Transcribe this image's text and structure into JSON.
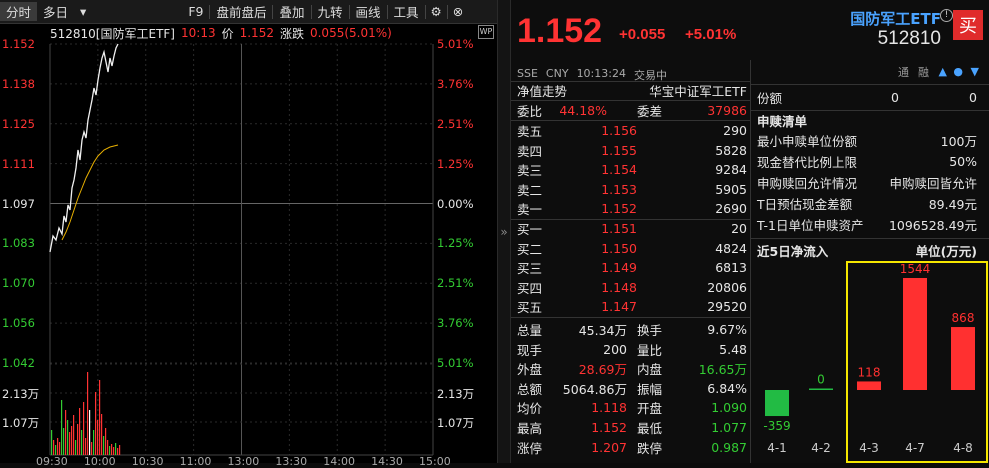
{
  "toolbar": {
    "items": [
      "分时",
      "多日",
      "▾",
      "F9",
      "盘前盘后",
      "叠加",
      "九转",
      "画线",
      "工具"
    ]
  },
  "chart_header": {
    "code_name": "512810[国防军工ETF]",
    "time": "10:13",
    "price_label": "价",
    "price": "1.152",
    "chg_label": "涨跌",
    "chg": "0.055(5.01%)"
  },
  "y_left": [
    "1.152",
    "1.138",
    "1.125",
    "1.111",
    "1.097",
    "1.083",
    "1.070",
    "1.056",
    "1.042"
  ],
  "y_right": [
    "5.01%",
    "3.76%",
    "2.51%",
    "1.25%",
    "0.00%",
    "1.25%",
    "2.51%",
    "3.76%",
    "5.01%"
  ],
  "vol_left": [
    "2.13万",
    "1.07万"
  ],
  "vol_right": [
    "2.13万",
    "1.07万"
  ],
  "x_labels": [
    "09:30",
    "10:00",
    "10:30",
    "11:00",
    "13:00",
    "13:30",
    "14:00",
    "14:30",
    "15:00"
  ],
  "quote": {
    "price": "1.152",
    "chg": "+0.055",
    "pct": "+5.01%",
    "name": "国防军工ETF",
    "code": "512810",
    "buy": "买",
    "info": [
      "SSE",
      "CNY",
      "10:13:24",
      "交易中"
    ],
    "nav_label": "净值走势",
    "index_name": "华宝中证军工ETF"
  },
  "ratio": {
    "wb_label": "委比",
    "wb": "44.18%",
    "wc_label": "委差",
    "wc": "37986"
  },
  "asks": [
    {
      "l": "卖五",
      "p": "1.156",
      "v": "290"
    },
    {
      "l": "卖四",
      "p": "1.155",
      "v": "5828"
    },
    {
      "l": "卖三",
      "p": "1.154",
      "v": "9284"
    },
    {
      "l": "卖二",
      "p": "1.153",
      "v": "5905"
    },
    {
      "l": "卖一",
      "p": "1.152",
      "v": "2690"
    }
  ],
  "bids": [
    {
      "l": "买一",
      "p": "1.151",
      "v": "20"
    },
    {
      "l": "买二",
      "p": "1.150",
      "v": "4824"
    },
    {
      "l": "买三",
      "p": "1.149",
      "v": "6813"
    },
    {
      "l": "买四",
      "p": "1.148",
      "v": "20806"
    },
    {
      "l": "买五",
      "p": "1.147",
      "v": "29520"
    }
  ],
  "stats": [
    {
      "a": "总量",
      "av": "45.34万",
      "b": "换手",
      "bv": "9.67%",
      "ac": "white",
      "bc": "white"
    },
    {
      "a": "现手",
      "av": "200",
      "b": "量比",
      "bv": "5.48",
      "ac": "white",
      "bc": "white"
    },
    {
      "a": "外盘",
      "av": "28.69万",
      "b": "内盘",
      "bv": "16.65万",
      "ac": "red",
      "bc": "green"
    },
    {
      "a": "总额",
      "av": "5064.86万",
      "b": "振幅",
      "bv": "6.84%",
      "ac": "white",
      "bc": "white"
    },
    {
      "a": "均价",
      "av": "1.118",
      "b": "开盘",
      "bv": "1.090",
      "ac": "red",
      "bc": "green"
    },
    {
      "a": "最高",
      "av": "1.152",
      "b": "最低",
      "bv": "1.077",
      "ac": "red",
      "bc": "green"
    },
    {
      "a": "涨停",
      "av": "1.207",
      "b": "跌停",
      "bv": "0.987",
      "ac": "red",
      "bc": "green"
    }
  ],
  "side": {
    "tabs": [
      "通",
      "融",
      "▲",
      "●",
      "▼"
    ],
    "shares_label": "份额",
    "shares_a": "0",
    "shares_b": "0",
    "list_title": "申赎清单",
    "items": [
      {
        "k": "最小申赎单位份额",
        "v": "100万"
      },
      {
        "k": "现金替代比例上限",
        "v": "50%"
      },
      {
        "k": "申购赎回允许情况",
        "v": "申购赎回皆允许"
      },
      {
        "k": "T日预估现金差额",
        "v": "89.49元"
      },
      {
        "k": "T-1日单位申赎资产",
        "v": "1096528.49元"
      }
    ],
    "flow_title": "近5日净流入",
    "flow_unit": "单位(万元)"
  },
  "flow_data": {
    "type": "bar",
    "categories": [
      "4-1",
      "4-2",
      "4-3",
      "4-7",
      "4-8"
    ],
    "values": [
      -359,
      0,
      118,
      1544,
      868
    ],
    "labels": [
      "-359",
      "0",
      "118",
      "1544",
      "868"
    ]
  }
}
